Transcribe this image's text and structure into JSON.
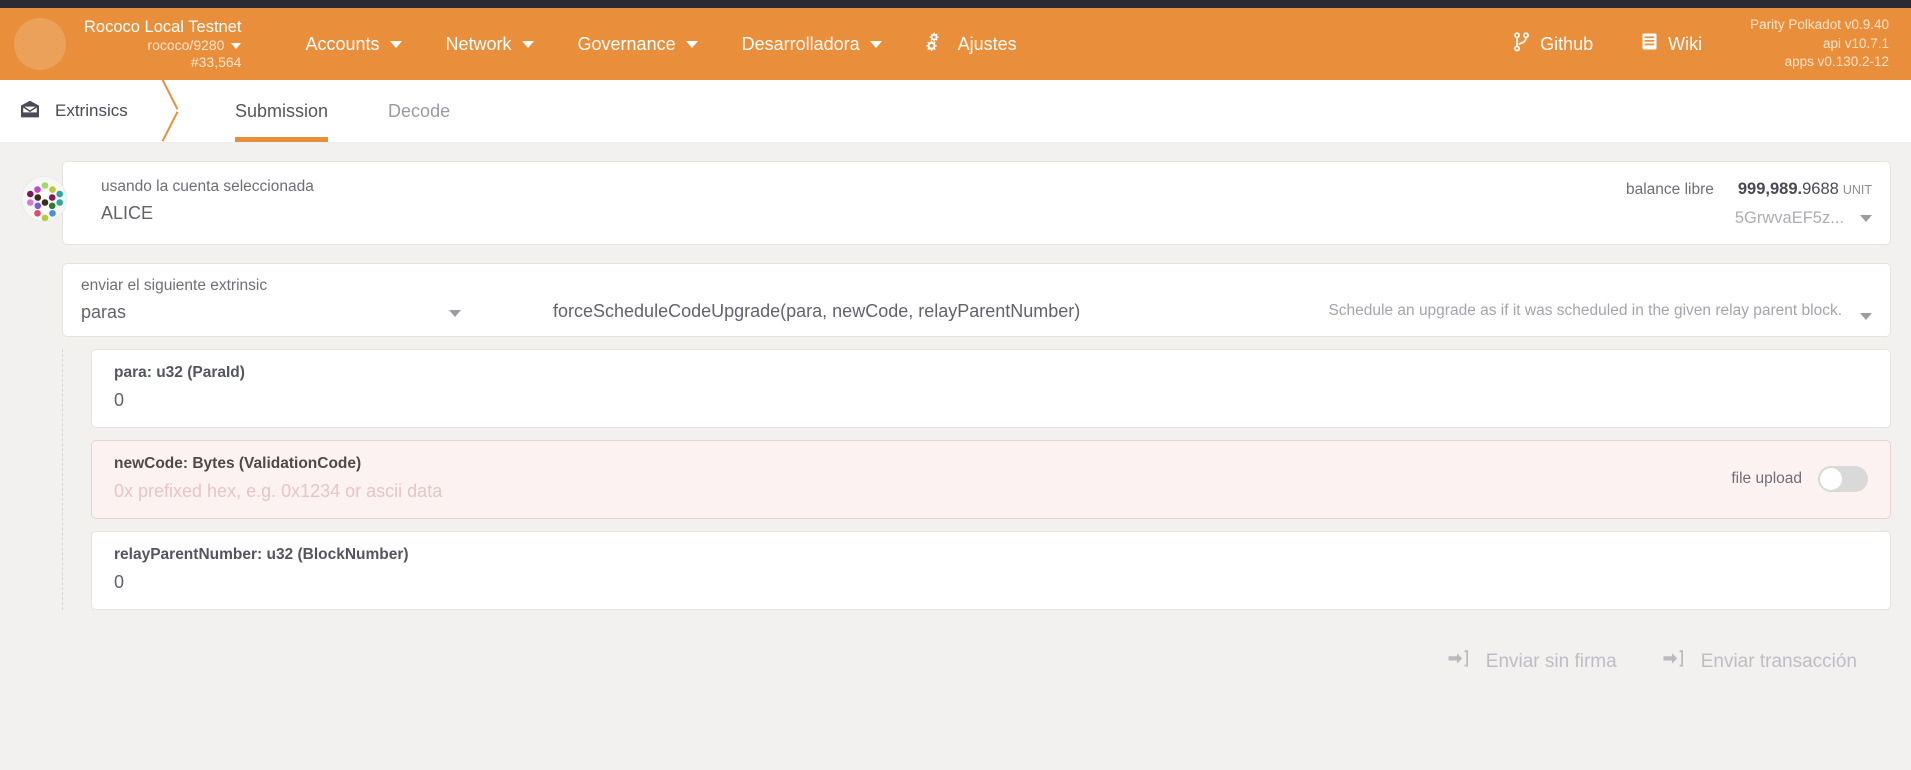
{
  "appbar": {
    "chain_name": "Rococo Local Testnet",
    "chain_spec": "rococo/9280",
    "block_number": "#33,564",
    "nav": [
      {
        "label": "Accounts",
        "icon": "chevron-down-icon",
        "has_caret": true
      },
      {
        "label": "Network",
        "icon": "chevron-down-icon",
        "has_caret": true
      },
      {
        "label": "Governance",
        "icon": "chevron-down-icon",
        "has_caret": true
      },
      {
        "label": "Desarrolladora",
        "icon": "chevron-down-icon",
        "has_caret": true
      },
      {
        "label": "Ajustes",
        "icon": "gears-icon",
        "has_caret": false
      }
    ],
    "links": [
      {
        "label": "Github",
        "icon": "git-branch-icon"
      },
      {
        "label": "Wiki",
        "icon": "book-icon"
      }
    ],
    "versions": {
      "node": "Parity Polkadot v0.9.40",
      "api": "api v10.7.1",
      "apps": "apps v0.130.2-12"
    },
    "accent_color": "#e98f3c",
    "text_color": "#ffffff",
    "muted_text_color": "#fbe4cd"
  },
  "tabbar": {
    "section_title": "Extrinsics",
    "section_icon": "envelope-icon",
    "tabs": [
      {
        "label": "Submission",
        "active": true
      },
      {
        "label": "Decode",
        "active": false
      }
    ]
  },
  "account": {
    "label": "usando la cuenta seleccionada",
    "value": "ALICE",
    "identicon": "polkadot-identicon",
    "balance_label": "balance libre",
    "balance_whole": "999,989.",
    "balance_fraction": "9688",
    "balance_unit": "UNIT",
    "address_short": "5GrwvaEF5z...",
    "dropdown_icon": "chevron-down-icon"
  },
  "extrinsic": {
    "label": "enviar el siguiente extrinsic",
    "pallet": "paras",
    "method": "forceScheduleCodeUpgrade(para, newCode, relayParentNumber)",
    "description": "Schedule an upgrade as if it was scheduled in the given relay parent block.",
    "dropdown_icon": "chevron-down-icon"
  },
  "params": [
    {
      "label": "para: u32 (ParaId)",
      "value": "0",
      "placeholder": "",
      "error": false,
      "has_upload_toggle": false
    },
    {
      "label": "newCode: Bytes (ValidationCode)",
      "value": "",
      "placeholder": "0x prefixed hex, e.g. 0x1234 or ascii data",
      "error": true,
      "has_upload_toggle": true,
      "upload_label": "file upload",
      "upload_on": false
    },
    {
      "label": "relayParentNumber: u32 (BlockNumber)",
      "value": "0",
      "placeholder": "",
      "error": false,
      "has_upload_toggle": false
    }
  ],
  "actions": [
    {
      "label": "Enviar sin firma",
      "icon": "sign-in-icon",
      "disabled": true
    },
    {
      "label": "Enviar transacción",
      "icon": "sign-in-icon",
      "disabled": true
    }
  ],
  "colors": {
    "accent": "#e98f3c",
    "page_bg": "#f2f1ef",
    "error_bg": "#fdf2f2",
    "error_border": "#f0cfcf"
  }
}
